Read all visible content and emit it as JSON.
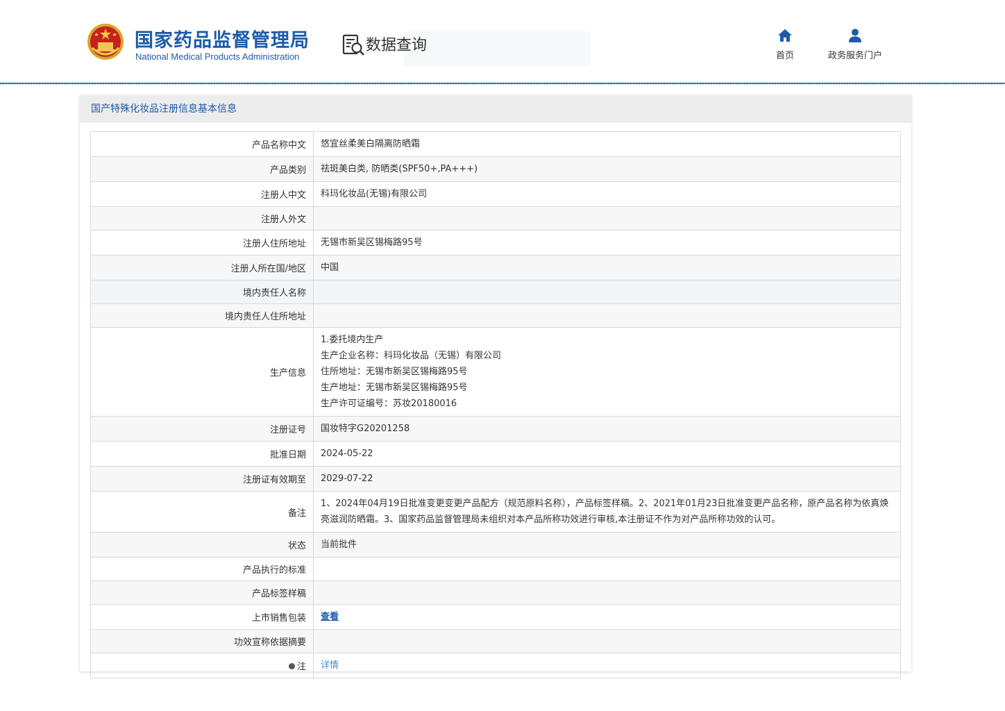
{
  "header": {
    "logo_cn": "国家药品监督管理局",
    "logo_en": "National Medical Products Administration",
    "query_label": "数据查询",
    "nav": [
      {
        "label": "首页",
        "icon": "home-icon"
      },
      {
        "label": "政务服务门户",
        "icon": "user-icon"
      }
    ],
    "brand_color": "#1d5ba8"
  },
  "panel": {
    "title": "国产特殊化妆品注册信息基本信息"
  },
  "rows": [
    {
      "key": "产品名称中文",
      "value": "悠宜丝柔美白隔离防晒霜"
    },
    {
      "key": "产品类别",
      "value": "祛斑美白类, 防晒类(SPF50+,PA+++)"
    },
    {
      "key": "注册人中文",
      "value": "科玛化妆品(无锡)有限公司"
    },
    {
      "key": "注册人外文",
      "value": ""
    },
    {
      "key": "注册人住所地址",
      "value": "无锡市新吴区锡梅路95号"
    },
    {
      "key": "注册人所在国/地区",
      "value": "中国"
    },
    {
      "key": "境内责任人名称",
      "value": ""
    },
    {
      "key": "境内责任人住所地址",
      "value": ""
    }
  ],
  "production": {
    "key": "生产信息",
    "lines": [
      "1.委托境内生产",
      "生产企业名称：科玛化妆品（无锡）有限公司",
      "住所地址：无锡市新吴区锡梅路95号",
      "生产地址：无锡市新吴区锡梅路95号",
      "生产许可证编号：苏妆20180016"
    ]
  },
  "rows2": [
    {
      "key": "注册证号",
      "value": "国妆特字G20201258"
    },
    {
      "key": "批准日期",
      "value": "2024-05-22"
    },
    {
      "key": "注册证有效期至",
      "value": "2029-07-22"
    },
    {
      "key": "备注",
      "value": "1、2024年04月19日批准变更变更产品配方（规范原料名称），产品标签样稿。2、2021年01月23日批准变更产品名称，原产品名称为依真焕亮滋润防晒霜。3、国家药品监督管理局未组织对本产品所称功效进行审核,本注册证不作为对产品所称功效的认可。"
    },
    {
      "key": "状态",
      "value": "当前批件"
    },
    {
      "key": "产品执行的标准",
      "value": ""
    },
    {
      "key": "产品标签样稿",
      "value": ""
    }
  ],
  "package_row": {
    "key": "上市销售包装",
    "link": "查看"
  },
  "efficacy_row": {
    "key": "功效宣称依据摘要",
    "value": ""
  },
  "note_row": {
    "key": "注",
    "link": "详情",
    "icon": "lightbulb-icon"
  }
}
